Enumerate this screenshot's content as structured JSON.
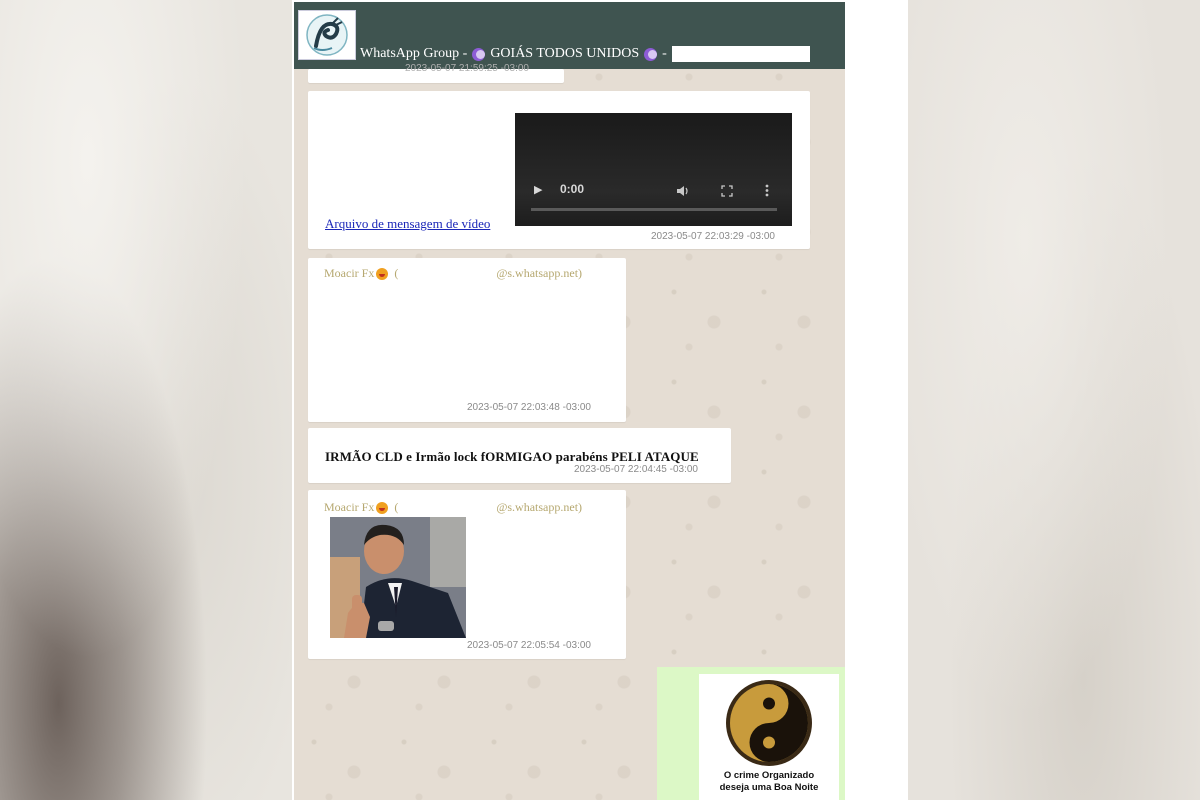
{
  "header": {
    "title": "WhatsApp Group - ",
    "group_name": "GOIÁS TODOS UNIDOS",
    "separator": "-"
  },
  "messages": [
    {
      "id": "partial-top",
      "timestamp": "2023-05-07 21:59:25 -03:00"
    },
    {
      "id": "video-message",
      "link_text": "Arquivo de mensagem de vídeo",
      "video_time": "0:00",
      "timestamp": "2023-05-07 22:03:29 -03:00"
    },
    {
      "id": "moacir-blank",
      "sender": "Moacir Fx",
      "sender_open": "(",
      "sender_domain": "@s.whatsapp.net)",
      "timestamp": "2023-05-07 22:03:48 -03:00"
    },
    {
      "id": "text-message",
      "text": "IRMÃO CLD e Irmão lock fORMIGAO parabéns PELI ATAQUE",
      "timestamp": "2023-05-07 22:04:45 -03:00"
    },
    {
      "id": "moacir-photo",
      "sender": "Moacir Fx",
      "sender_open": "(",
      "sender_domain": "@s.whatsapp.net)",
      "timestamp": "2023-05-07 22:05:54 -03:00"
    },
    {
      "id": "sticker",
      "caption_line1": "O crime Organizado",
      "caption_line2": "deseja uma Boa Noite"
    }
  ],
  "icons": {
    "avatar": "dragon-logo-icon",
    "moon": "moon-emoji-icon",
    "smile": "smiling-emoji-icon",
    "play": "play-icon",
    "volume": "volume-icon",
    "fullscreen": "fullscreen-icon",
    "more": "more-vertical-icon",
    "yin_yang": "yin-yang-icon"
  },
  "colors": {
    "header_bg": "#3f5450",
    "chat_bg": "#e5ddd3",
    "sender_name": "#b6a870",
    "link": "#1a26b8",
    "outgoing_bubble": "#dcf8c6"
  }
}
